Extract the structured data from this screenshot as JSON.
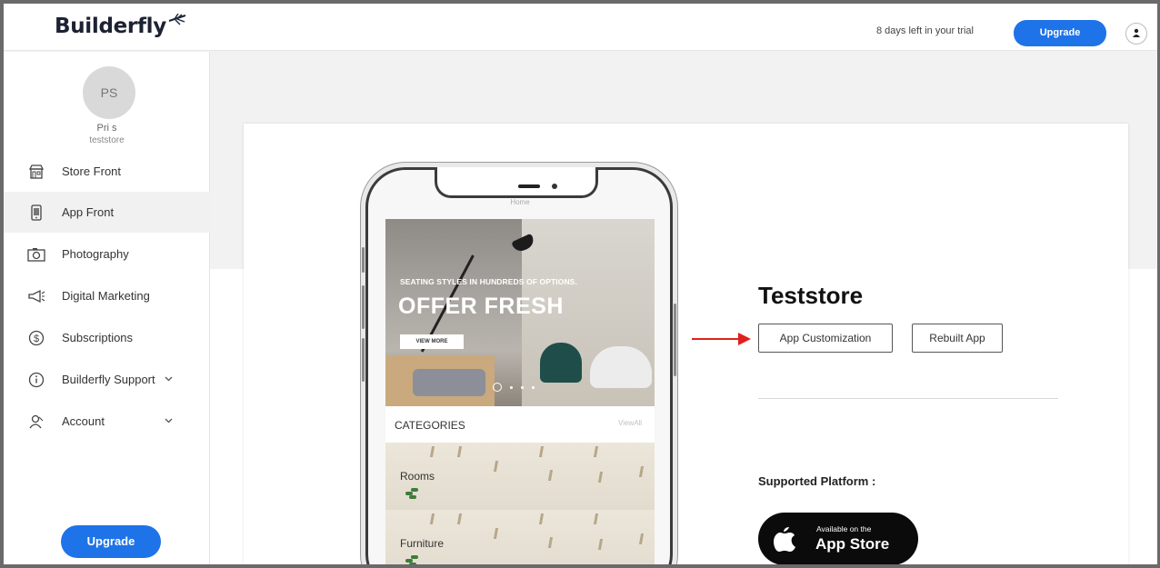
{
  "header": {
    "logo_text": "Builderfly",
    "trial_text": "8 days left in your trial",
    "upgrade_label": "Upgrade",
    "user_icon": "user-icon"
  },
  "sidebar": {
    "avatar_initials": "PS",
    "profile_name": "Pri s",
    "profile_store": "teststore",
    "items": [
      {
        "label": "Store Front",
        "icon": "storefront-icon",
        "active": false
      },
      {
        "label": "App Front",
        "icon": "mobile-app-icon",
        "active": true
      },
      {
        "label": "Photography",
        "icon": "camera-icon",
        "active": false
      },
      {
        "label": "Digital Marketing",
        "icon": "megaphone-icon",
        "active": false
      },
      {
        "label": "Subscriptions",
        "icon": "dollar-circle-icon",
        "active": false
      },
      {
        "label": "Builderfly Support",
        "icon": "info-circle-icon",
        "active": false,
        "expandable": true
      },
      {
        "label": "Account",
        "icon": "account-icon",
        "active": false,
        "expandable": true
      }
    ],
    "upgrade_label": "Upgrade"
  },
  "phone_preview": {
    "home_label": "Home",
    "hero_tagline": "SEATING STYLES IN HUNDREDS OF OPTIONS.",
    "hero_title": "OFFER FRESH",
    "hero_button": "VIEW MORE",
    "categories_title": "CATEGORIES",
    "categories_viewall": "ViewAll",
    "categories": [
      "Rooms",
      "Furniture"
    ]
  },
  "main": {
    "store_title": "Teststore",
    "app_customization_label": "App Customization",
    "rebuilt_app_label": "Rebuilt App",
    "supported_platform_label": "Supported Platform :",
    "appstore_small": "Available on the",
    "appstore_big": "App Store"
  },
  "colors": {
    "accent": "#1e73e8",
    "arrow": "#e0201c",
    "appstore_bg": "#0b0b0b"
  }
}
